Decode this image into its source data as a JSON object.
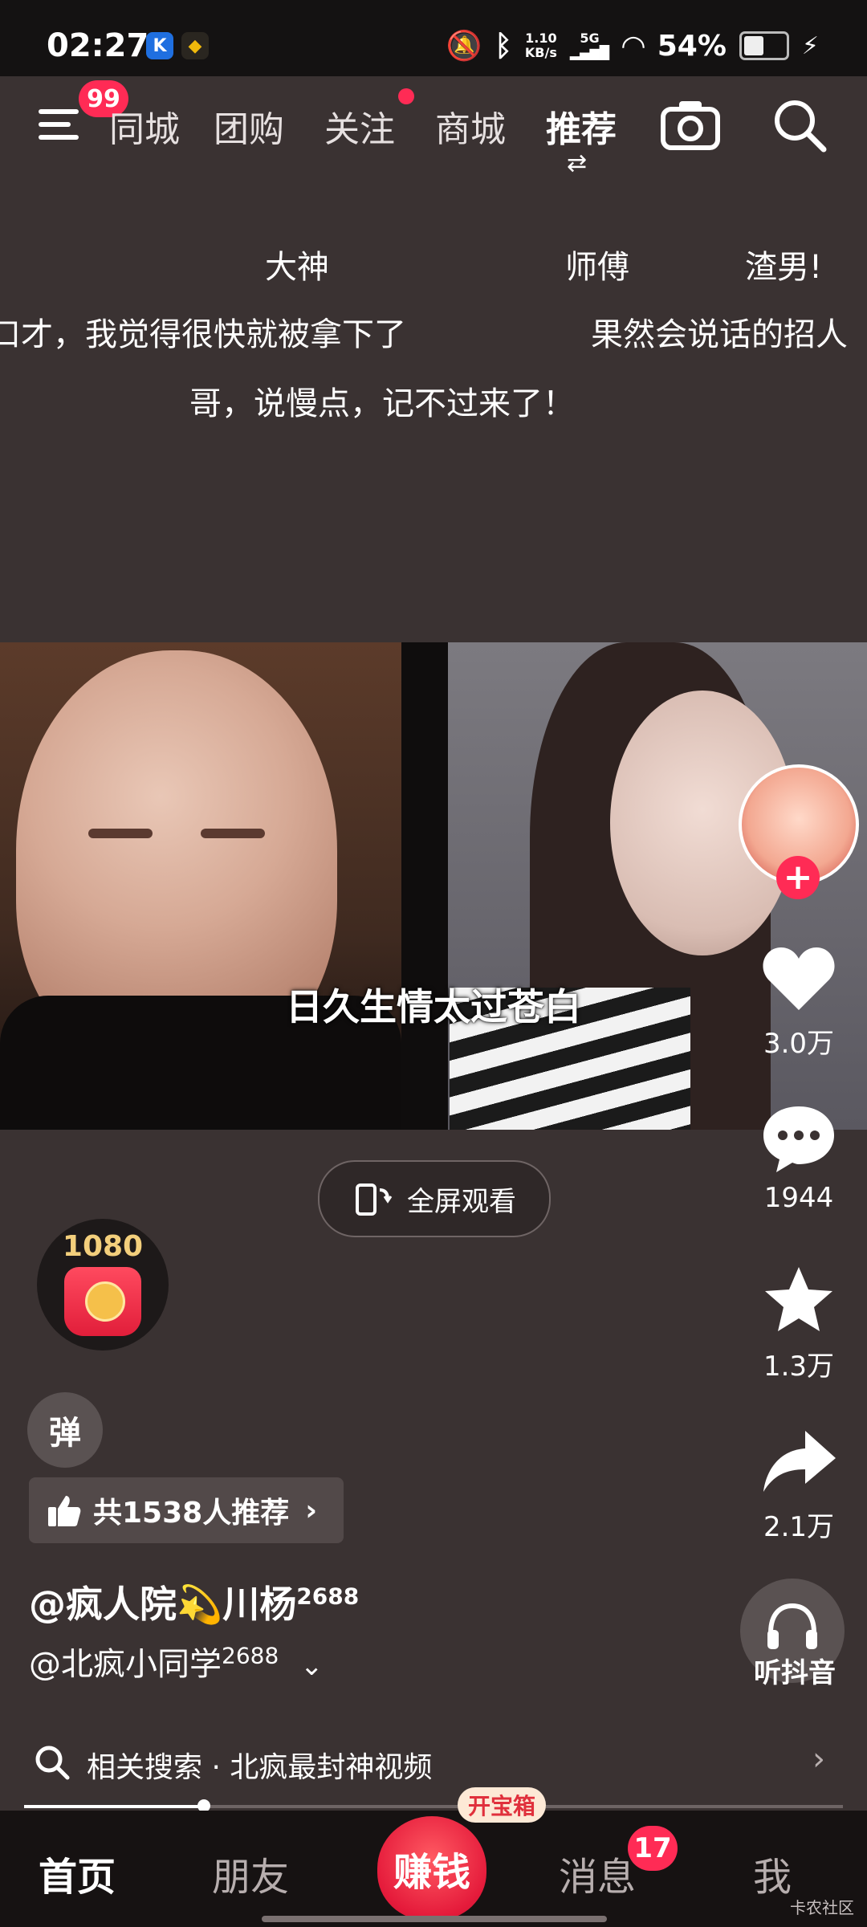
{
  "status_bar": {
    "time": "02:27",
    "net_speed_top": "1.10",
    "net_speed_bottom": "KB/s",
    "signal_label": "5G",
    "battery": "54%",
    "battery_level": 0.54
  },
  "top_nav": {
    "menu_badge": "99",
    "tabs": [
      "同城",
      "团购",
      "关注",
      "商城",
      "推荐"
    ],
    "active_tab": "推荐",
    "switch_symbol": "⇄"
  },
  "danmaku": {
    "row1": [
      "大神",
      "师傅",
      "渣男!"
    ],
    "row2": [
      "口才，我觉得很快就被拿下了",
      "果然会说话的招人"
    ],
    "row3": "哥，说慢点，记不过来了！"
  },
  "video": {
    "subtitle": "日久生情太过苍白"
  },
  "fullscreen_label": "全屏观看",
  "right_actions": {
    "likes": "3.0万",
    "comments": "1944",
    "favorites": "1.3万",
    "shares": "2.1万",
    "listen": "听抖音"
  },
  "red_packet_amount": "1080",
  "danmu_toggle": "弹",
  "recommend_text": "共1538人推荐",
  "author": {
    "name": "@疯人院💫川杨",
    "name_sup": "2688",
    "coauthor": "@北疯小同学",
    "coauthor_sup": "2688"
  },
  "related_search": "相关搜索 · 北疯最封神视频",
  "progress": 0.22,
  "bottom_nav": {
    "home": "首页",
    "friends": "朋友",
    "earn": "赚钱",
    "treasure": "开宝箱",
    "messages": "消息",
    "messages_badge": "17",
    "me": "我"
  },
  "watermark": "卡农社区"
}
